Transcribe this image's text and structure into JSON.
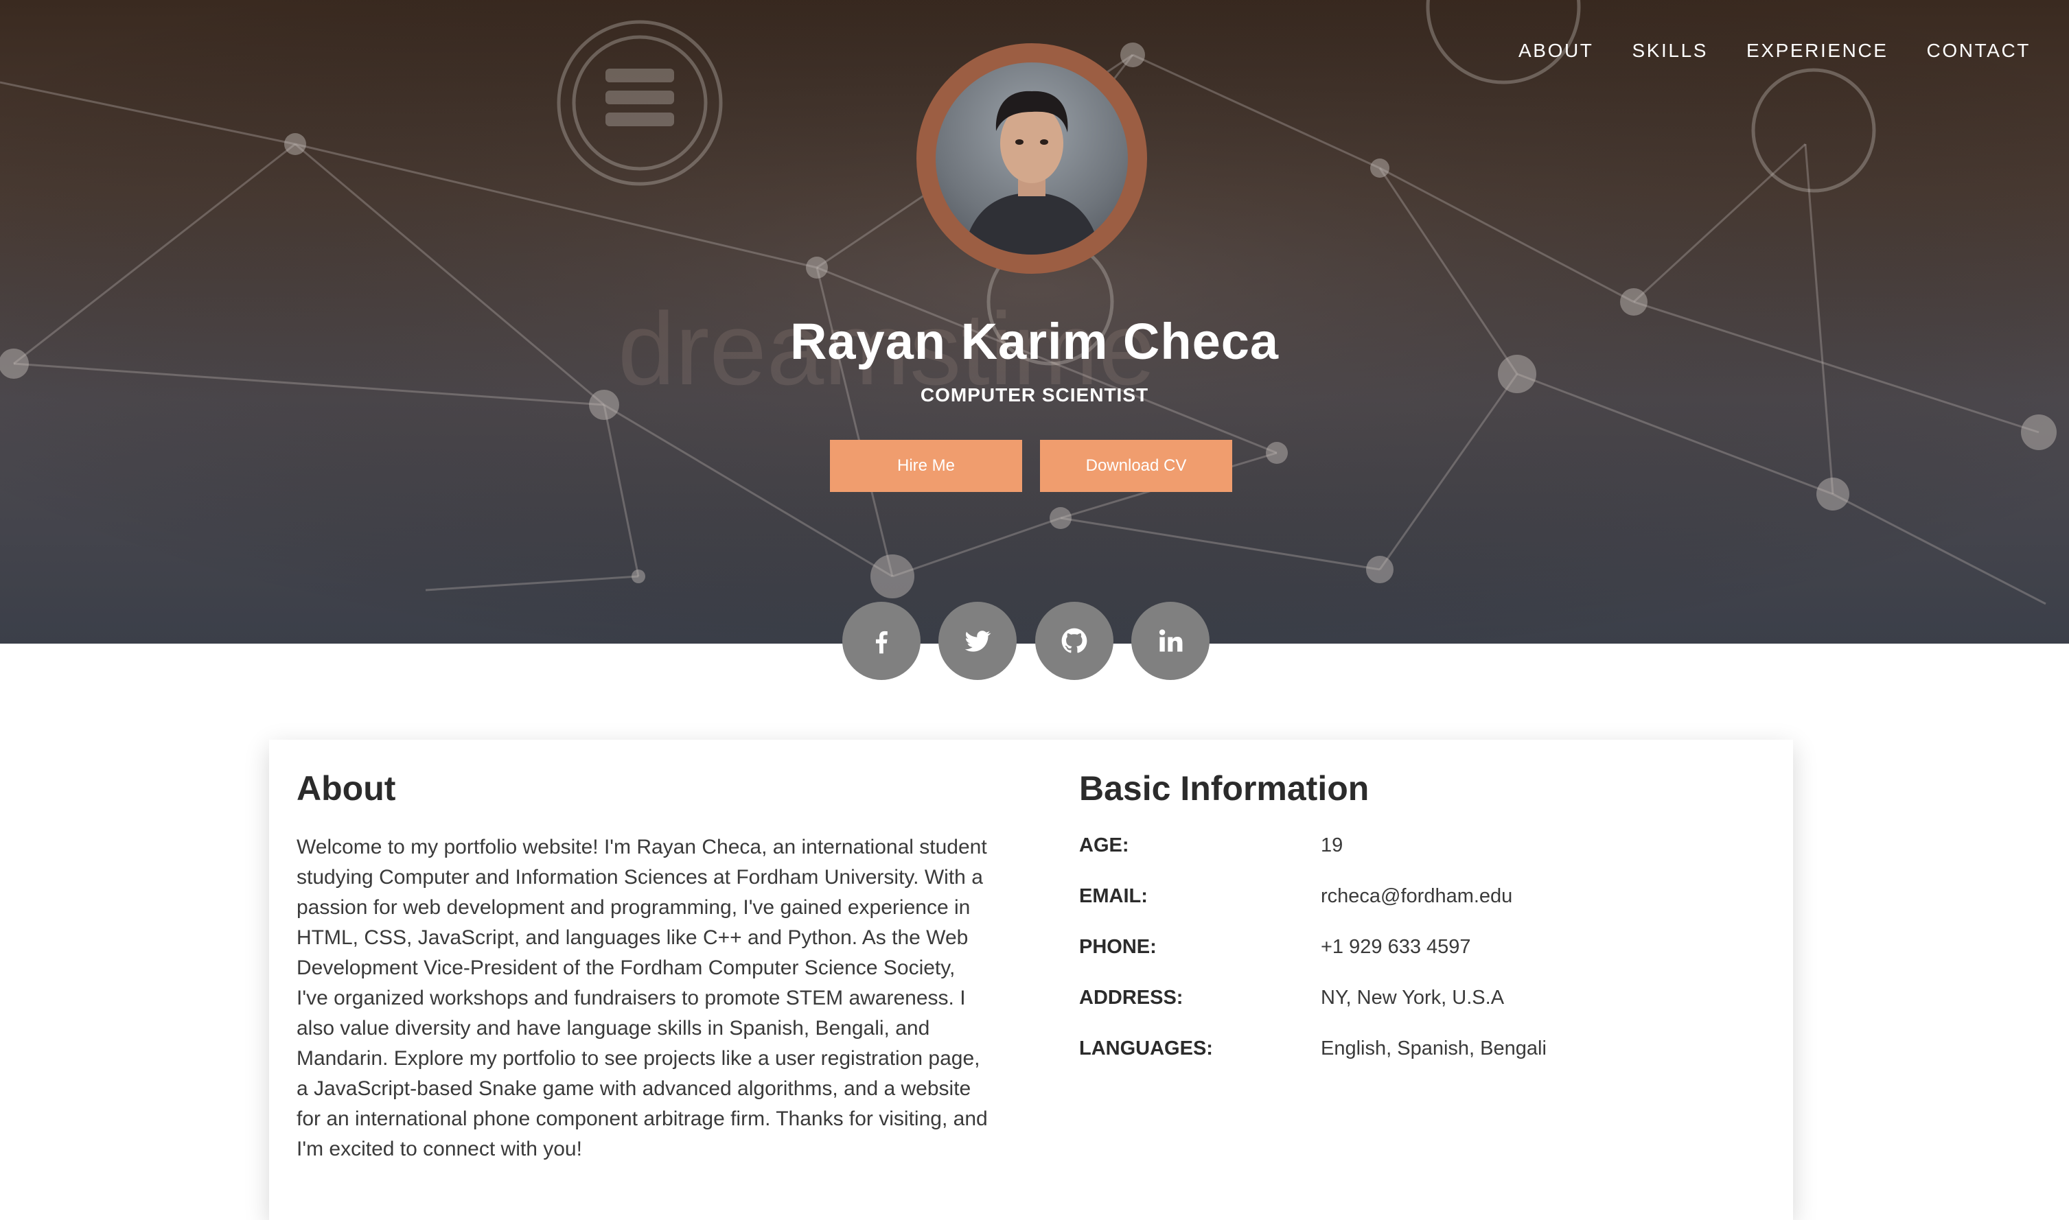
{
  "nav": {
    "items": [
      {
        "label": "ABOUT"
      },
      {
        "label": "SKILLS"
      },
      {
        "label": "EXPERIENCE"
      },
      {
        "label": "CONTACT"
      }
    ]
  },
  "hero": {
    "name": "Rayan Karim Checa",
    "role": "COMPUTER SCIENTIST",
    "hire_button": "Hire Me",
    "cv_button": "Download CV",
    "social": [
      {
        "icon": "facebook-icon"
      },
      {
        "icon": "twitter-icon"
      },
      {
        "icon": "github-icon"
      },
      {
        "icon": "linkedin-icon"
      }
    ]
  },
  "about": {
    "title": "About",
    "text": "Welcome to my portfolio website! I'm Rayan Checa, an international student studying Computer and Information Sciences at Fordham University. With a passion for web development and programming, I've gained experience in HTML, CSS, JavaScript, and languages like C++ and Python. As the Web Development Vice-President of the Fordham Computer Science Society, I've organized workshops and fundraisers to promote STEM awareness. I also value diversity and have language skills in Spanish, Bengali, and Mandarin. Explore my portfolio to see projects like a user registration page, a JavaScript-based Snake game with advanced algorithms, and a website for an international phone component arbitrage firm. Thanks for visiting, and I'm excited to connect with you!"
  },
  "basic_info": {
    "title": "Basic Information",
    "rows": [
      {
        "label": "AGE:",
        "value": "19"
      },
      {
        "label": "EMAIL:",
        "value": "rcheca@fordham.edu"
      },
      {
        "label": "PHONE:",
        "value": "+1 929 633 4597"
      },
      {
        "label": "ADDRESS:",
        "value": "NY, New York, U.S.A"
      },
      {
        "label": "LANGUAGES:",
        "value": "English, Spanish, Bengali"
      }
    ]
  },
  "colors": {
    "accent": "#f09d6e",
    "avatar_ring": "#9c5e43",
    "social_bg": "#808080"
  }
}
